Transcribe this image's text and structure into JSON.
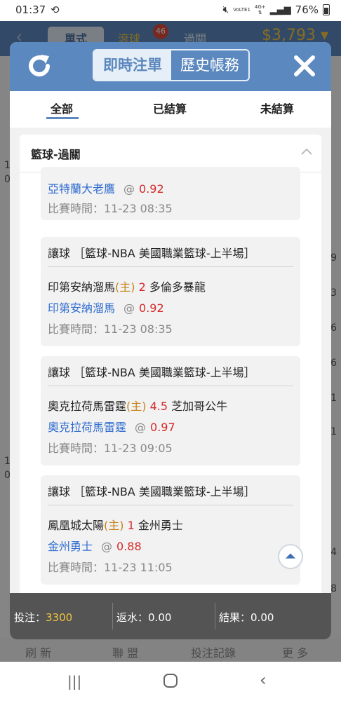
{
  "status_bar": {
    "time": "01:37",
    "battery": "76%",
    "net_top": "VoLTE1",
    "net_side": "4G+"
  },
  "background": {
    "tabs": [
      "單式",
      "滾球",
      "過關"
    ],
    "roll_badge": "46",
    "balance": "$3,793",
    "right_edge_digits": [
      "9",
      "3",
      "6",
      "6",
      "1",
      "1",
      "4",
      "8"
    ],
    "left_edge_digits": [
      "1",
      "0",
      "1",
      "0"
    ],
    "bottom_nav": [
      "刷 新",
      "聯 盟",
      "投注記錄",
      "更 多"
    ]
  },
  "modal": {
    "segments": {
      "active": "即時注單",
      "inactive": "歷史帳務"
    },
    "filters": [
      "全部",
      "已結算",
      "未結算"
    ],
    "group_title": "籃球-過關",
    "partial_card": {
      "pick_team": "亞特蘭大老鷹",
      "at": "@",
      "odds": "0.92",
      "time_label": "比賽時間：11-23 08:35"
    },
    "cards": [
      {
        "header": "讓球 ［籃球-NBA 美國職業籃球-上半場］",
        "home_team": "印第安納溜馬",
        "home_tag": "(主)",
        "handicap": "2",
        "away_team": "多倫多暴龍",
        "pick_team": "印第安納溜馬",
        "at": "@",
        "odds": "0.92",
        "time_label": "比賽時間：11-23 08:35"
      },
      {
        "header": "讓球 ［籃球-NBA 美國職業籃球-上半場］",
        "home_team": "奧克拉荷馬雷霆",
        "home_tag": "(主)",
        "handicap": "4.5",
        "away_team": "芝加哥公牛",
        "pick_team": "奧克拉荷馬雷霆",
        "at": "@",
        "odds": "0.97",
        "time_label": "比賽時間：11-23 09:05"
      },
      {
        "header": "讓球 ［籃球-NBA 美國職業籃球-上半場］",
        "home_team": "鳳凰城太陽",
        "home_tag": "(主)",
        "handicap": "1",
        "away_team": "金州勇士",
        "pick_team": "金州勇士",
        "at": "@",
        "odds": "0.88",
        "time_label": "比賽時間：11-23 11:05"
      }
    ],
    "summary": {
      "stake_label": "投注：",
      "stake_value": "3300",
      "rebate_label": "返水：",
      "rebate_value": "0.00",
      "result_label": "結果：",
      "result_value": "0.00"
    }
  },
  "colors": {
    "header_blue": "#5b88be",
    "home_orange": "#c8811a",
    "odds_red": "#d52a2a",
    "pick_blue": "#2e6bcf",
    "stake_yellow": "#f2c53d"
  }
}
